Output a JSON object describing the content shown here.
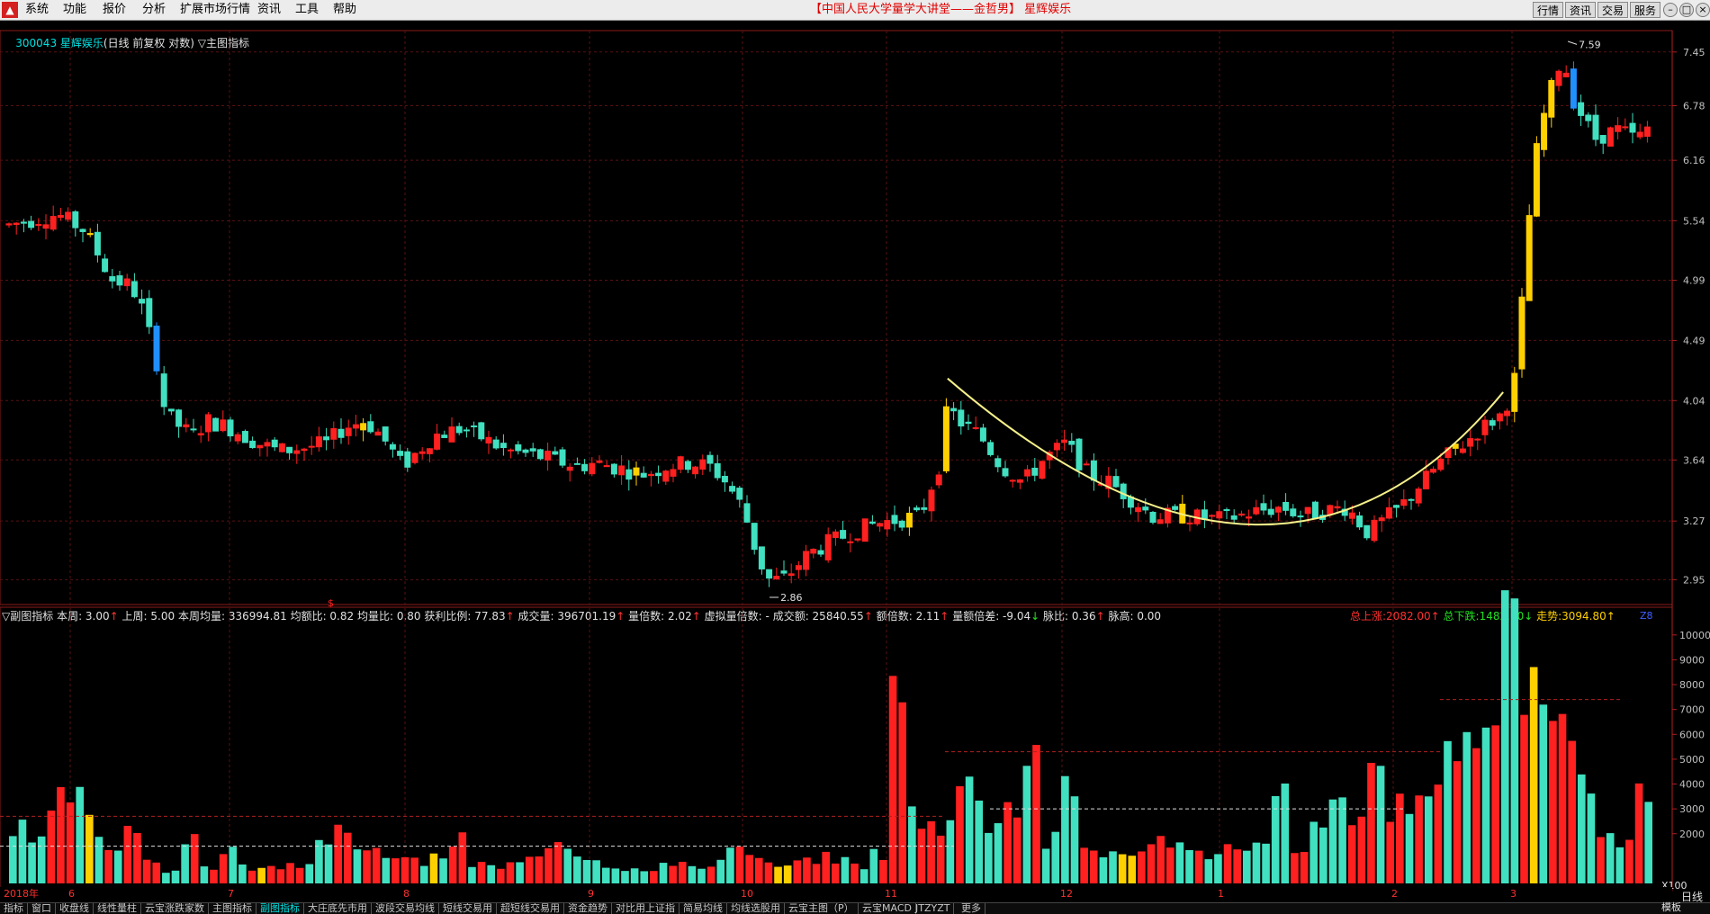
{
  "menu": {
    "items": [
      "系统",
      "功能",
      "报价",
      "分析",
      "扩展市场行情",
      "资讯",
      "工具",
      "帮助"
    ],
    "banner": "【中国人民大学量学大讲堂——金哲男】 星辉娱乐",
    "right_buttons": [
      "行情",
      "资讯",
      "交易",
      "服务"
    ]
  },
  "main_header": {
    "code": "300043",
    "name": "星辉娱乐",
    "mode": "(日线 前复权 对数)",
    "indicator": "▽主图指标"
  },
  "price_chart": {
    "ylabels": [
      "7.45",
      "6.78",
      "6.16",
      "5.54",
      "4.99",
      "4.49",
      "4.04",
      "3.64",
      "3.27",
      "2.95"
    ],
    "high_label": "7.59",
    "low_label": "2.86",
    "annotation_marker": "$"
  },
  "sub_header": {
    "left": [
      {
        "label": "▽副图指标",
        "value": "",
        "arrow": "",
        "color": "white"
      },
      {
        "label": "本周:",
        "value": "3.00",
        "arrow": "↑",
        "color": "white"
      },
      {
        "label": "上周:",
        "value": "5.00",
        "arrow": "",
        "color": "white"
      },
      {
        "label": "本周均量:",
        "value": "336994.81",
        "arrow": "",
        "color": "white"
      },
      {
        "label": "均额比:",
        "value": "0.82",
        "arrow": "",
        "color": "white"
      },
      {
        "label": "均量比:",
        "value": "0.80",
        "arrow": "",
        "color": "white"
      },
      {
        "label": "获利比例:",
        "value": "77.83",
        "arrow": "↑",
        "color": "white"
      },
      {
        "label": "成交量:",
        "value": "396701.19",
        "arrow": "↑",
        "color": "white"
      },
      {
        "label": "量倍数:",
        "value": "2.02",
        "arrow": "↑",
        "color": "white"
      },
      {
        "label": "虚拟量倍数:",
        "value": "-",
        "arrow": "",
        "color": "white"
      },
      {
        "label": "成交额:",
        "value": "25840.55",
        "arrow": "↑",
        "color": "white"
      },
      {
        "label": "额倍数:",
        "value": "2.11",
        "arrow": "↑",
        "color": "white"
      },
      {
        "label": "量额倍差:",
        "value": "-9.04",
        "arrow": "↓",
        "color": "white"
      },
      {
        "label": "脉比:",
        "value": "0.36",
        "arrow": "↑",
        "color": "white"
      },
      {
        "label": "脉高:",
        "value": "0.00",
        "arrow": "",
        "color": "white"
      }
    ],
    "right": [
      {
        "label": "总上涨:",
        "value": "2082.00",
        "arrow": "↑",
        "color": "red"
      },
      {
        "label": "总下跌:",
        "value": "1482.00",
        "arrow": "↓",
        "color": "green"
      },
      {
        "label": "走势:",
        "value": "3094.80",
        "arrow": "↑",
        "color": "yellow"
      }
    ]
  },
  "volume_chart": {
    "ylabels": [
      "10000",
      "9000",
      "8000",
      "7000",
      "6000",
      "5000",
      "4000",
      "3000",
      "2000"
    ],
    "scale_label": "X100"
  },
  "time_axis": {
    "year_label": "2018年",
    "months": [
      "6",
      "7",
      "8",
      "9",
      "10",
      "11",
      "12",
      "1",
      "2",
      "3"
    ]
  },
  "tabs": [
    "指标",
    "窗口",
    "收盘线",
    "线性量柱",
    "云宝涨跌家数",
    "主图指标",
    "副图指标",
    "大庄底先市用",
    "波段交易均线",
    "短线交易用",
    "超短线交易用",
    "资金趋势",
    "对比用上证指",
    "简易均线",
    "均线选股用",
    "云宝主图（P）",
    "云宝MACD",
    "JTZYZT",
    "更多"
  ],
  "active_tab": "副图指标",
  "period": "日线",
  "template_label": "模板",
  "chart_data": {
    "type": "candlestick",
    "series": [
      {
        "name": "price_path",
        "x": [
          0,
          45,
          70,
          95,
          110,
          120,
          135,
          145,
          160,
          170,
          185,
          205,
          230,
          250,
          275,
          295,
          310,
          330,
          345,
          365,
          380,
          395,
          420,
          440,
          460,
          480,
          500,
          525,
          545,
          570,
          590,
          610,
          630,
          650,
          665,
          680,
          695,
          705,
          712,
          720,
          740,
          760,
          780,
          800,
          825,
          845,
          862,
          870,
          880,
          900,
          920,
          940,
          960,
          980,
          1000,
          1020,
          1040,
          1060,
          1090,
          1120,
          1140,
          1160,
          1180,
          1200,
          1220,
          1240,
          1260,
          1275,
          1290,
          1310,
          1330,
          1350,
          1365,
          1385,
          1395,
          1400,
          1405,
          1410,
          1415,
          1425,
          1440,
          1450,
          1470,
          1490,
          1510,
          1525
        ],
        "y": [
          5.5,
          5.6,
          5.45,
          5.0,
          4.95,
          4.85,
          4.4,
          3.95,
          3.85,
          3.8,
          3.9,
          3.85,
          3.75,
          3.7,
          3.72,
          3.75,
          3.85,
          3.9,
          3.8,
          3.6,
          3.7,
          3.8,
          3.85,
          3.78,
          3.7,
          3.68,
          3.65,
          3.6,
          3.62,
          3.58,
          3.55,
          3.6,
          3.62,
          3.6,
          3.5,
          3.35,
          3.05,
          2.95,
          2.95,
          2.96,
          3.08,
          3.15,
          3.2,
          3.25,
          3.28,
          3.3,
          3.6,
          4.0,
          3.9,
          3.8,
          3.6,
          3.5,
          3.65,
          3.75,
          3.55,
          3.5,
          3.4,
          3.3,
          3.3,
          3.28,
          3.3,
          3.33,
          3.35,
          3.3,
          3.33,
          3.35,
          3.2,
          3.28,
          3.35,
          3.5,
          3.65,
          3.75,
          3.85,
          3.95,
          4.15,
          4.6,
          5.0,
          5.7,
          6.2,
          6.8,
          7.4,
          6.85,
          6.4,
          6.5,
          6.4,
          6.6
        ]
      },
      {
        "name": "volume",
        "note": "volume in hundreds of shares (X100)",
        "values": [
          2200,
          1600,
          3300,
          3700,
          2400,
          1200,
          2700,
          1000,
          600,
          1700,
          700,
          1500,
          700,
          600,
          700,
          800,
          2200,
          2000,
          1200,
          1400,
          1100,
          900,
          1200,
          1800,
          800,
          700,
          900,
          1000,
          1400,
          1200,
          1100,
          800,
          600,
          700,
          1000,
          800,
          600,
          1200,
          1500,
          1000,
          700,
          900,
          1100,
          1000,
          800,
          1300,
          7800,
          3000,
          2500,
          3500,
          4100,
          2800,
          3400,
          5600,
          1800,
          4000,
          1500,
          1400,
          1100,
          1600,
          1900,
          1400,
          1200,
          1600,
          1300,
          1500,
          3700,
          1200,
          2300,
          3800,
          2600,
          4100,
          3400,
          3100,
          4900,
          6100,
          5800,
          8000,
          10000,
          7500,
          6400,
          5700,
          3900,
          2600,
          1900,
          3500
        ]
      }
    ],
    "curve": {
      "name": "arc",
      "from_x": 870,
      "to_x": 1385,
      "min_y": 3.25
    },
    "ylim_price": [
      2.86,
      7.59
    ],
    "ylim_volume": [
      0,
      10500
    ]
  }
}
